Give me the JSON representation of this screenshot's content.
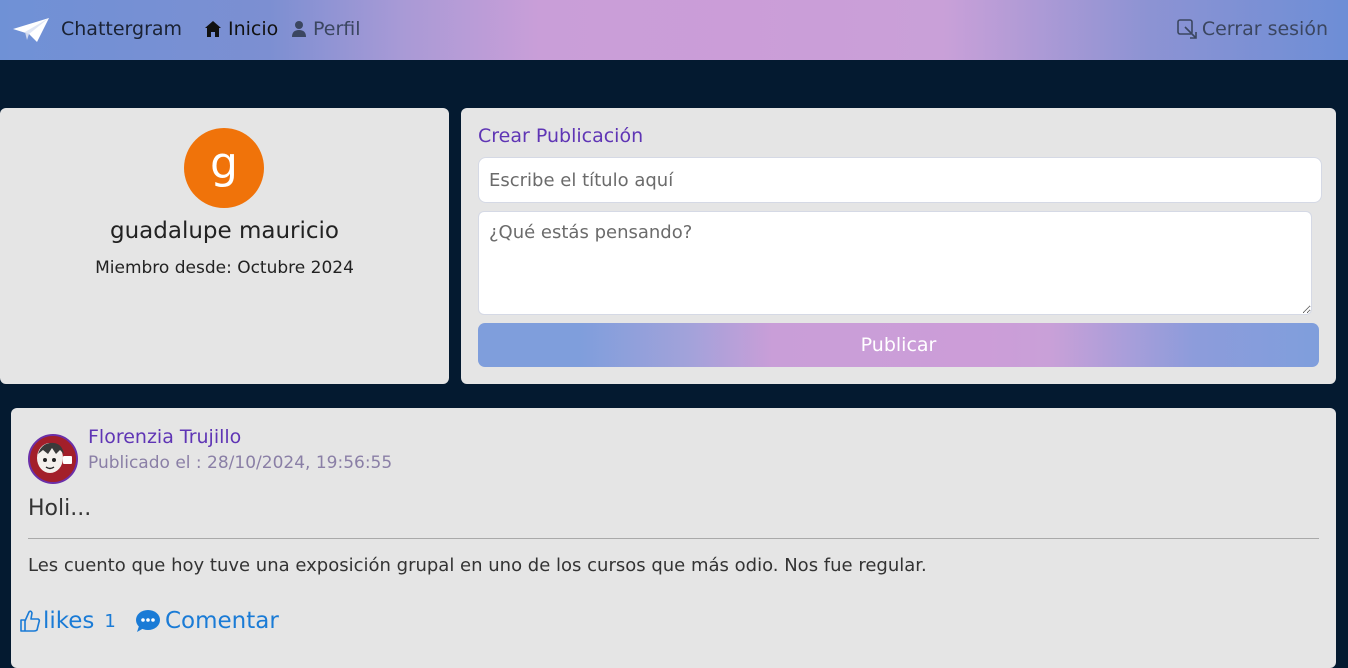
{
  "navbar": {
    "brand": "Chattergram",
    "home_label": "Inicio",
    "profile_label": "Perfil",
    "logout_label": "Cerrar sesión"
  },
  "profile": {
    "avatar_letter": "g",
    "name": "guadalupe mauricio",
    "member_since": "Miembro desde: Octubre 2024",
    "avatar_color": "#f0730a"
  },
  "create_post": {
    "heading": "Crear Publicación",
    "title_placeholder": "Escribe el título aquí",
    "body_placeholder": "¿Qué estás pensando?",
    "submit_label": "Publicar"
  },
  "post": {
    "author": "Florenzia Trujillo",
    "published": "Publicado el : 28/10/2024, 19:56:55",
    "title": "Holi...",
    "body": "Les cuento que hoy tuve una exposición grupal en uno de los cursos que más odio. Nos fue regular.",
    "likes_label": "likes",
    "likes_count": "1",
    "comment_label": "Comentar"
  },
  "colors": {
    "background": "#041a30",
    "card": "#e5e5e5",
    "accent_purple": "#5f35b5",
    "link_blue": "#1a7bd6"
  }
}
